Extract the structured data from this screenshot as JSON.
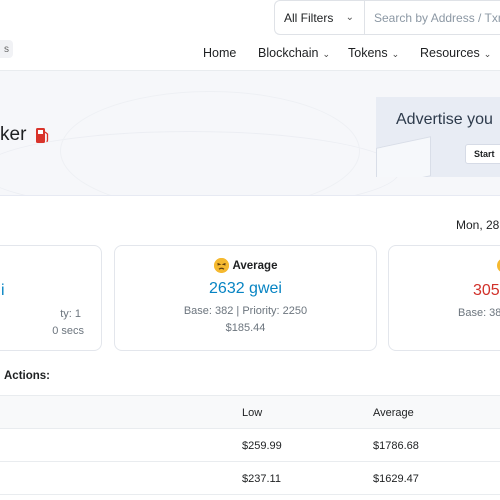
{
  "search": {
    "filter_label": "All Filters",
    "placeholder": "Search by Address / Txn H"
  },
  "logo": {
    "fragment": "s"
  },
  "nav": {
    "items": [
      {
        "label": "Home",
        "has_caret": false
      },
      {
        "label": "Blockchain",
        "has_caret": true
      },
      {
        "label": "Tokens",
        "has_caret": true
      },
      {
        "label": "Resources",
        "has_caret": true
      }
    ]
  },
  "hero": {
    "title_fragment": "ker"
  },
  "ad": {
    "text": "Advertise you",
    "button": "Start"
  },
  "date": "Mon, 28",
  "cards": {
    "left": {
      "value": "i",
      "detail": "ty: 1",
      "time": "0 secs"
    },
    "middle": {
      "label": "Average",
      "value": "2632 gwei",
      "detail": "Base: 382 | Priority: 2250",
      "cost": "$185.44"
    },
    "right": {
      "value": "305",
      "detail": "Base: 38"
    }
  },
  "actions_label": "Actions:",
  "table": {
    "headers": [
      "Low",
      "Average"
    ],
    "rows": [
      [
        "$259.99",
        "$1786.68"
      ],
      [
        "$237.11",
        "$1629.47"
      ]
    ]
  },
  "colors": {
    "blue_value": "#0784c3",
    "red_value": "#d1312a",
    "hero_bg": "#f6f7fa"
  }
}
